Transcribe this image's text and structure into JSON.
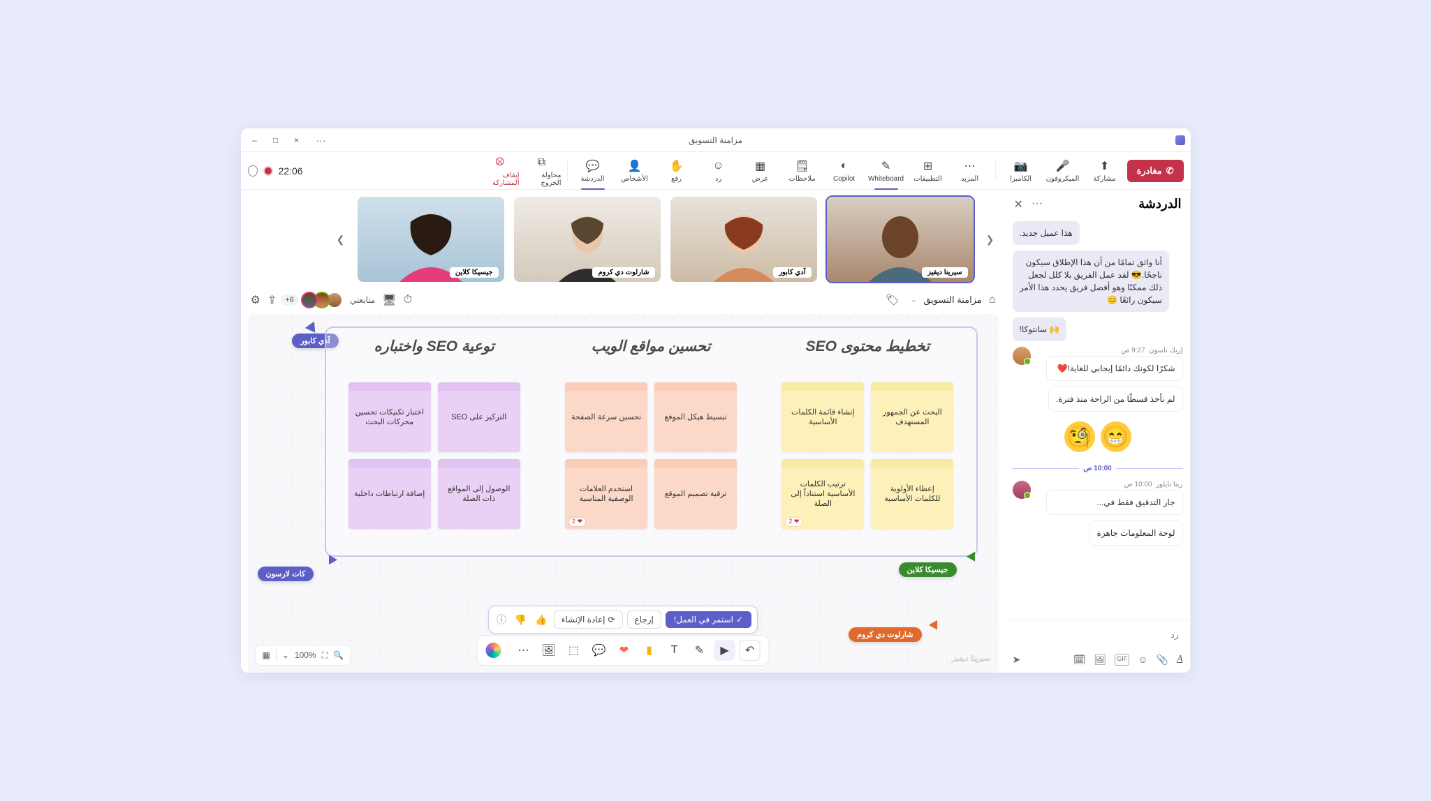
{
  "window": {
    "title": "مزامنة التسويق"
  },
  "titlebar": {
    "close": "×",
    "max": "□",
    "min": "–",
    "more": "···"
  },
  "toolbar": {
    "leave": "مغادرة",
    "items": [
      {
        "key": "share",
        "label": "مشاركة"
      },
      {
        "key": "mic",
        "label": "الميكروفون"
      },
      {
        "key": "camera",
        "label": "الكاميرا"
      },
      {
        "key": "more",
        "label": "المزيد"
      },
      {
        "key": "apps",
        "label": "التطبيقات"
      },
      {
        "key": "whiteboard",
        "label": "Whiteboard"
      },
      {
        "key": "copilot",
        "label": "Copilot"
      },
      {
        "key": "notes",
        "label": "ملاحظات"
      },
      {
        "key": "view",
        "label": "عرض"
      },
      {
        "key": "react",
        "label": "رد"
      },
      {
        "key": "raise",
        "label": "رفع"
      },
      {
        "key": "people",
        "label": "الأشخاص"
      },
      {
        "key": "chat",
        "label": "الدردشة"
      },
      {
        "key": "breakout",
        "label": "محاولة الخروج"
      },
      {
        "key": "stopshare",
        "label": "إيقاف المشاركة"
      }
    ],
    "time": "22:06"
  },
  "participants": [
    {
      "name": "سيرينا ديفيز",
      "bg1": "#d8cfc3",
      "bg2": "#a9886e",
      "skin": "#6b4328",
      "shirt": "#4a6b7a"
    },
    {
      "name": "آدي كابور",
      "bg1": "#e8e2da",
      "bg2": "#cdbca5",
      "skin": "#ecc7a8",
      "shirt": "#d58a5b",
      "hair": "#8a3b1e"
    },
    {
      "name": "شارلوت دي كروم",
      "bg1": "#efeae4",
      "bg2": "#d4cabc",
      "skin": "#eac7a8",
      "shirt": "#2e2e2e",
      "hair": "#5a4530"
    },
    {
      "name": "جيسيكا كلاين",
      "bg1": "#cfe0ea",
      "bg2": "#a8c4d6",
      "skin": "#d39a6b",
      "shirt": "#e63d7a",
      "hair": "#2a1a12"
    }
  ],
  "wb": {
    "title": "مزامنة التسويق",
    "follow": "متابعتي",
    "plus": "6+"
  },
  "board": {
    "cursor_adi": "آدي كابور",
    "cursor_kat": "كات لارسون",
    "cursor_jessica": "جيسيكا كلاين",
    "cursor_charlotte": "شارلوت دي كروم",
    "ghost_label": "سيرينا ديفيز",
    "columns": [
      {
        "title": "تخطيط محتوى SEO",
        "color": "yellow",
        "notes": [
          "البحث عن الجمهور المستهدف",
          "إنشاء قائمة الكلمات الأساسية",
          "إعطاء الأولوية للكلمات الأساسية",
          "ترتيب الكلمات الأساسية استناداً إلى الصلة"
        ],
        "react": [
          false,
          false,
          false,
          true
        ]
      },
      {
        "title": "تحسين مواقع الويب",
        "color": "orange",
        "notes": [
          "تبسيط هيكل الموقع",
          "تحسين سرعة الصفحة",
          "ترقية تصميم الموقع",
          "استخدم العلامات الوصفية المناسبة"
        ],
        "react": [
          false,
          false,
          false,
          true
        ]
      },
      {
        "title": "توعية SEO واختباره",
        "color": "purple",
        "notes": [
          "التركيز على SEO",
          "اختبار تكنيكات تحسين محركات البحث",
          "الوصول إلى المواقع ذات الصلة",
          "إضافة ارتباطات داخلية"
        ],
        "react": [
          false,
          false,
          false,
          false
        ]
      }
    ]
  },
  "ai": {
    "keep": "استمر في العمل!",
    "retry": "إرجاع",
    "regen": "إعادة الإنشاء"
  },
  "bottom": {
    "zoom": "100%"
  },
  "chat": {
    "heading": "الدردشة",
    "messages": {
      "m0": "هذا عميل جديد.",
      "m1": "أنا واثق تمامًا من أن هذا الإطلاق سيكون ناجحًا.😎 لقد عمل الفريق بلا كلل لجعل ذلك ممكنًا وهو أفضل فريق يحدد هذا الأمر سيكون رائعًا 😊",
      "m2": "🙌 سانتوكا!",
      "sender1": "إريك ناسون",
      "time1": "9:27 ص",
      "m3": "شكرًا لكونك دائمًا إيجابي للغاية!❤️",
      "m4": "لم نأخذ قسطًا من الراحة منذ فترة.",
      "sep_time": "10:00 ص",
      "sender2": "ريتا نايلور",
      "time2": "10:00 ص",
      "m5": "جار التدقيق فقط في...",
      "m6": "لوحة المعلومات جاهزة"
    },
    "reply": "رد"
  }
}
